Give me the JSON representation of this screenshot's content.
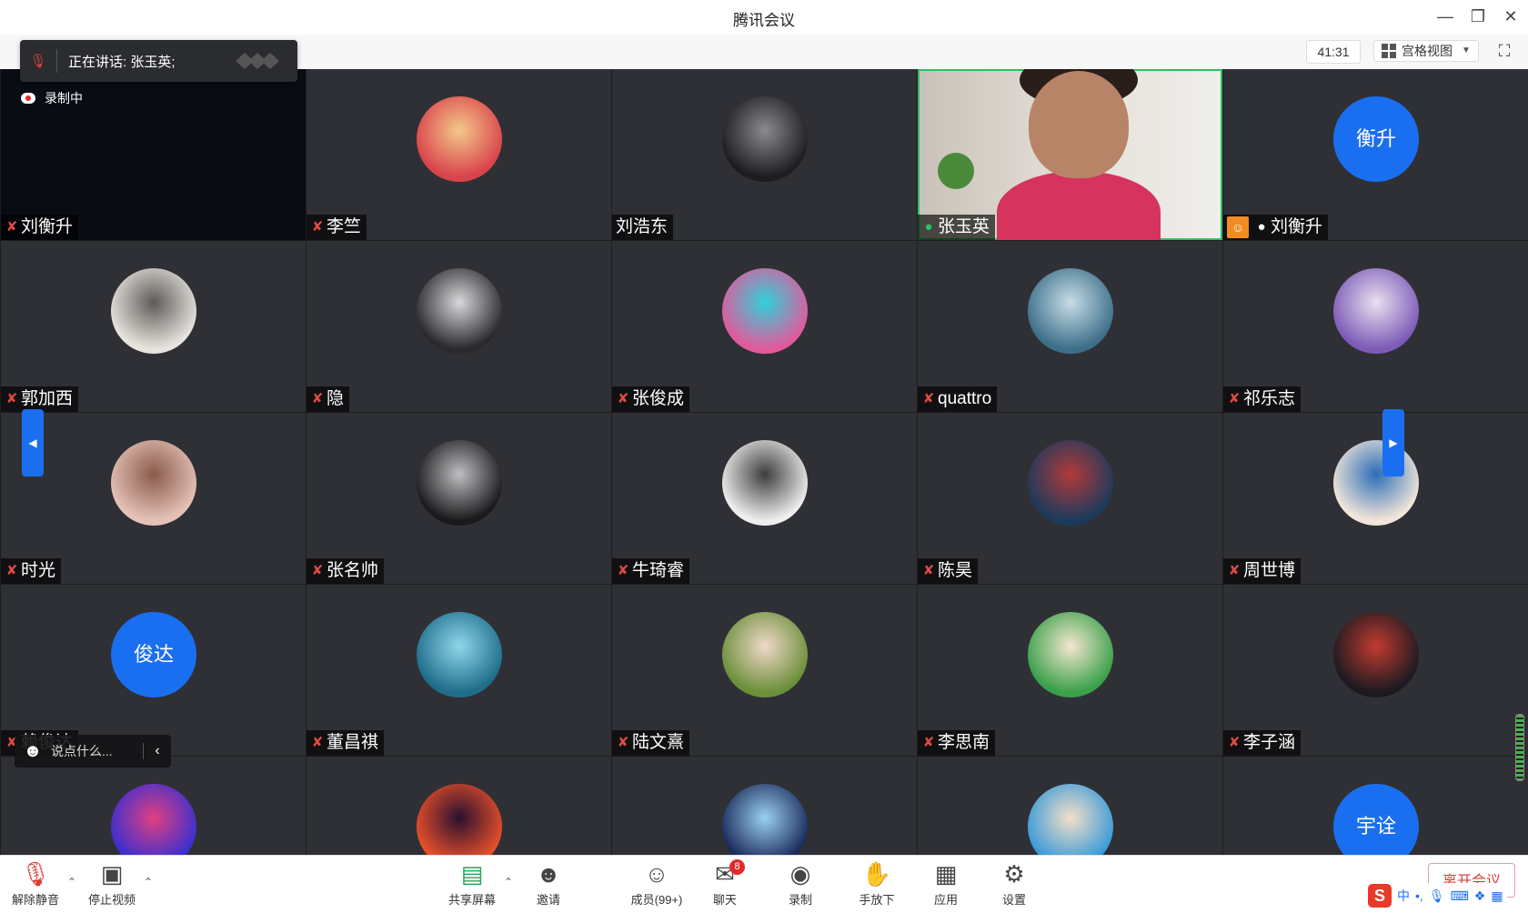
{
  "window": {
    "title": "腾讯会议"
  },
  "topbar": {
    "timer": "41:31",
    "view_label": "宫格视图"
  },
  "speaking_popup": {
    "text": "正在讲话: 张玉英;"
  },
  "recording": {
    "label": "录制中"
  },
  "tiles": [
    {
      "name": "刘衡升",
      "mic": "muted",
      "avatar": "none",
      "avatar_text": "",
      "bg": "#0a0c14",
      "recording_indicator": true
    },
    {
      "name": "李竺",
      "mic": "muted",
      "avatar": "image",
      "colors": [
        "#d9434a",
        "#f3c98b"
      ]
    },
    {
      "name": "刘浩东",
      "mic": "none",
      "avatar": "image",
      "colors": [
        "#1d1d1f",
        "#8a8a90"
      ]
    },
    {
      "name": "张玉英",
      "mic": "speaking",
      "avatar": "video",
      "colors": [
        "#c9c2b8",
        "#d6335f"
      ]
    },
    {
      "name": "刘衡升",
      "mic": "white",
      "avatar": "text",
      "avatar_text": "衡升",
      "host": true
    },
    {
      "name": "郭加西",
      "mic": "muted",
      "avatar": "image",
      "colors": [
        "#e7e4df",
        "#5e5b57"
      ]
    },
    {
      "name": "隐",
      "mic": "muted",
      "avatar": "image",
      "colors": [
        "#2a2a2e",
        "#d8d8da"
      ]
    },
    {
      "name": "张俊成",
      "mic": "muted",
      "avatar": "image",
      "colors": [
        "#e25a9c",
        "#2fd0d9"
      ]
    },
    {
      "name": "quattro",
      "mic": "muted",
      "avatar": "image",
      "colors": [
        "#3d6f8a",
        "#c7dde6"
      ]
    },
    {
      "name": "祁乐志",
      "mic": "muted",
      "avatar": "image",
      "colors": [
        "#7d5bb7",
        "#e9e0f0"
      ]
    },
    {
      "name": "时光",
      "mic": "muted",
      "avatar": "image",
      "colors": [
        "#e5c2b7",
        "#8a5a4a"
      ]
    },
    {
      "name": "张名帅",
      "mic": "muted",
      "avatar": "image",
      "colors": [
        "#1a1a1c",
        "#bfbfc2"
      ]
    },
    {
      "name": "牛琦睿",
      "mic": "muted",
      "avatar": "image",
      "colors": [
        "#eeeeee",
        "#3d3d3d"
      ]
    },
    {
      "name": "陈昊",
      "mic": "muted",
      "avatar": "image",
      "colors": [
        "#1b3a5c",
        "#b23a3a"
      ]
    },
    {
      "name": "周世博",
      "mic": "muted",
      "avatar": "image",
      "colors": [
        "#f2e6d8",
        "#2a6db8"
      ]
    },
    {
      "name": "赖俊达",
      "mic": "muted",
      "avatar": "text",
      "avatar_text": "俊达"
    },
    {
      "name": "董昌祺",
      "mic": "muted",
      "avatar": "image",
      "colors": [
        "#1f6d8a",
        "#8fd6ea"
      ]
    },
    {
      "name": "陆文熹",
      "mic": "muted",
      "avatar": "image",
      "colors": [
        "#6b8f3a",
        "#f0d8c8"
      ]
    },
    {
      "name": "李思南",
      "mic": "muted",
      "avatar": "image",
      "colors": [
        "#3aa04a",
        "#f4e7d0"
      ]
    },
    {
      "name": "李子涵",
      "mic": "muted",
      "avatar": "image",
      "colors": [
        "#1a1a20",
        "#c23a30"
      ]
    },
    {
      "name": "",
      "mic": "none",
      "avatar": "image",
      "colors": [
        "#3a2fd0",
        "#e04080"
      ]
    },
    {
      "name": "",
      "mic": "none",
      "avatar": "image",
      "colors": [
        "#e8502a",
        "#2a1030"
      ]
    },
    {
      "name": "",
      "mic": "none",
      "avatar": "image",
      "colors": [
        "#1a2a5a",
        "#9ad0f0"
      ]
    },
    {
      "name": "",
      "mic": "none",
      "avatar": "image",
      "colors": [
        "#3a9ad8",
        "#f4e0c8"
      ]
    },
    {
      "name": "",
      "mic": "none",
      "avatar": "text",
      "avatar_text": "宇诠"
    }
  ],
  "chat_input": {
    "placeholder": "说点什么..."
  },
  "toolbar": {
    "unmute": "解除静音",
    "stop_video": "停止视频",
    "share_screen": "共享屏幕",
    "invite": "邀请",
    "members": "成员(99+)",
    "chat": "聊天",
    "chat_badge": "8",
    "record": "录制",
    "hand_down": "手放下",
    "apps": "应用",
    "settings": "设置",
    "leave": "离开会议"
  },
  "ime": {
    "lang": "中"
  },
  "colors": {
    "accent": "#1a6ff0",
    "muted_mic": "#e04a42",
    "speaking_mic": "#28c262",
    "host_badge": "#f08c22"
  }
}
